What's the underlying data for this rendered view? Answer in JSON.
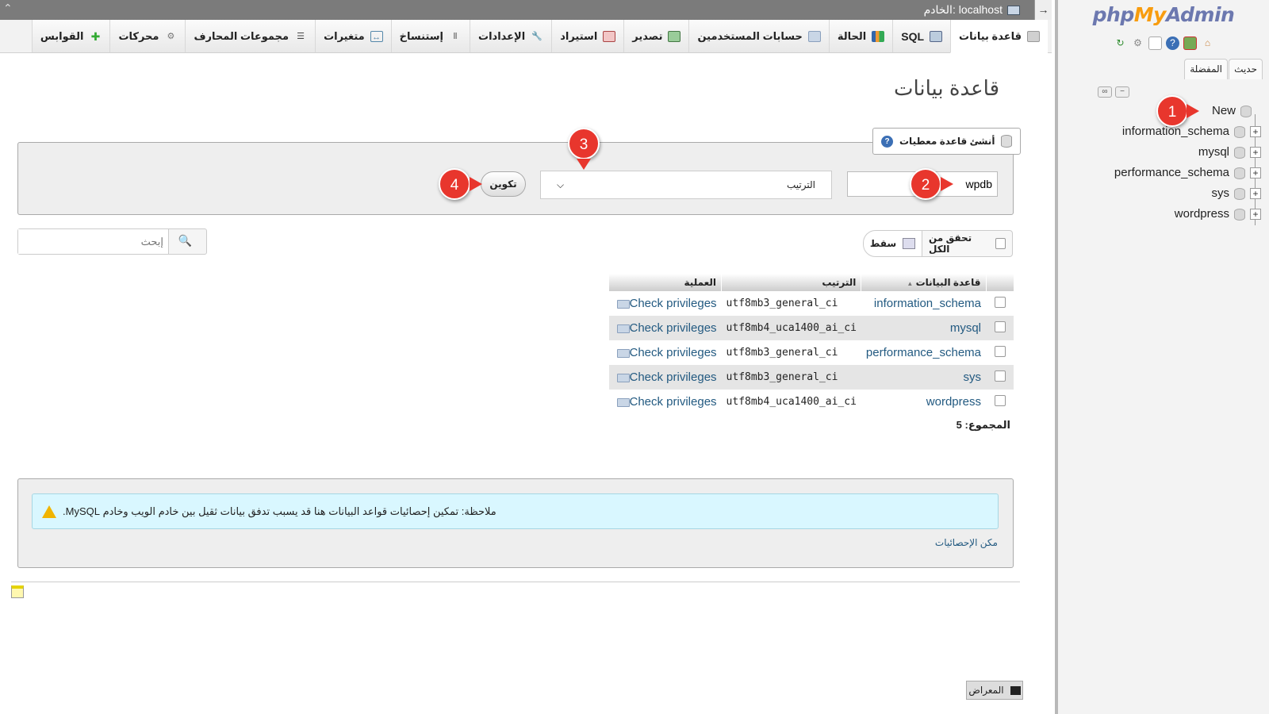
{
  "topbar": {
    "server_label": "الخادم: localhost"
  },
  "nav": {
    "logo": {
      "php": "php",
      "my": "My",
      "admin": "Admin"
    },
    "tab_recent": "حديث",
    "tab_favorites": "المفضلة",
    "new_label": "New",
    "databases": [
      "information_schema",
      "mysql",
      "performance_schema",
      "sys",
      "wordpress"
    ]
  },
  "tabs": [
    {
      "label": "قاعدة بيانات",
      "icon": "database-icon"
    },
    {
      "label": "SQL",
      "icon": "sql-icon"
    },
    {
      "label": "الحالة",
      "icon": "status-icon"
    },
    {
      "label": "حسابات المستخدمين",
      "icon": "users-icon"
    },
    {
      "label": "تصدير",
      "icon": "export-icon"
    },
    {
      "label": "استيراد",
      "icon": "import-icon"
    },
    {
      "label": "الإعدادات",
      "icon": "settings-icon"
    },
    {
      "label": "إستنساخ",
      "icon": "replication-icon"
    },
    {
      "label": "متغيرات",
      "icon": "variables-icon"
    },
    {
      "label": "مجموعات المحارف",
      "icon": "charset-icon"
    },
    {
      "label": "محركات",
      "icon": "engines-icon"
    },
    {
      "label": "القوابس",
      "icon": "plugins-icon"
    }
  ],
  "main": {
    "page_title": "قاعدة بيانات",
    "create": {
      "legend": "أنشئ قاعدة معطيات",
      "db_name_value": "wpdb",
      "collation_selected": "الترتيب",
      "create_button": "تكوين"
    },
    "search_placeholder": "إبحث",
    "select_all_label": "تحقق من الكل",
    "drop_label": "سقط",
    "table": {
      "headers": {
        "database": "قاعدة البيانات",
        "collation": "الترتيب",
        "action": "العملية"
      },
      "rows": [
        {
          "name": "information_schema",
          "collation": "utf8mb3_general_ci",
          "action": "Check privileges"
        },
        {
          "name": "mysql",
          "collation": "utf8mb4_uca1400_ai_ci",
          "action": "Check privileges"
        },
        {
          "name": "performance_schema",
          "collation": "utf8mb3_general_ci",
          "action": "Check privileges"
        },
        {
          "name": "sys",
          "collation": "utf8mb3_general_ci",
          "action": "Check privileges"
        },
        {
          "name": "wordpress",
          "collation": "utf8mb4_uca1400_ai_ci",
          "action": "Check privileges"
        }
      ],
      "total": "المجموع: 5"
    },
    "notice": "ملاحظة: تمكين إحصائيات قواعد البيانات هنا قد يسبب تدفق بيانات ثقيل بين خادم الويب وخادم MySQL.",
    "enable_stats": "مكن الإحصائيات"
  },
  "annotations": [
    "1",
    "2",
    "3",
    "4"
  ],
  "console_label": "المعراض",
  "colors": {
    "accent_red": "#e8362d",
    "link": "#235a81",
    "logo_blue": "#6c78af",
    "logo_orange": "#f89c0e"
  }
}
